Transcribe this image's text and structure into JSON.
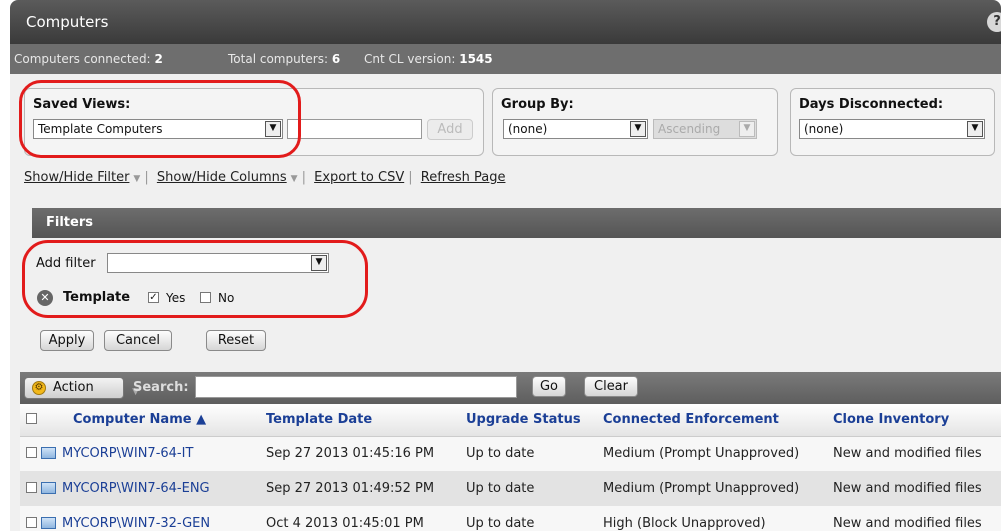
{
  "window": {
    "title": "Computers",
    "help_icon": "?"
  },
  "info": {
    "connected_label": "Computers connected:",
    "connected_value": "2",
    "total_label": "Total computers:",
    "total_value": "6",
    "cl_label": "Cnt CL version:",
    "cl_value": "1545"
  },
  "saved_views": {
    "label": "Saved Views:",
    "value": "Template Computers",
    "name_value": "",
    "add_label": "Add"
  },
  "group_by": {
    "label": "Group By:",
    "value": "(none)",
    "order_value": "Ascending"
  },
  "days_disconnected": {
    "label": "Days Disconnected:",
    "value": "(none)"
  },
  "links": {
    "show_hide_filter": "Show/Hide Filter",
    "show_hide_columns": "Show/Hide Columns",
    "export_csv": "Export to CSV",
    "refresh": "Refresh Page"
  },
  "filters": {
    "heading": "Filters",
    "add_filter_label": "Add filter",
    "add_filter_value": "",
    "template_label": "Template",
    "yes_label": "Yes",
    "yes_checked": true,
    "no_label": "No",
    "no_checked": false
  },
  "filter_buttons": {
    "apply": "Apply",
    "cancel": "Cancel",
    "reset": "Reset"
  },
  "toolbar": {
    "action_label": "Action",
    "search_label": "Search:",
    "search_value": "",
    "go_label": "Go",
    "clear_label": "Clear"
  },
  "table": {
    "columns": [
      "Computer Name ▲",
      "Template Date",
      "Upgrade Status",
      "Connected Enforcement",
      "Clone Inventory"
    ],
    "rows": [
      {
        "name": "MYCORP\\WIN7-64-IT",
        "template_date": "Sep 27 2013 01:45:16 PM",
        "upgrade": "Up to date",
        "enforcement": "Medium (Prompt Unapproved)",
        "clone": "New and modified files"
      },
      {
        "name": "MYCORP\\WIN7-64-ENG",
        "template_date": "Sep 27 2013 01:49:52 PM",
        "upgrade": "Up to date",
        "enforcement": "Medium (Prompt Unapproved)",
        "clone": "New and modified files"
      },
      {
        "name": "MYCORP\\WIN7-32-GEN",
        "template_date": "Oct 4 2013 01:45:01 PM",
        "upgrade": "Up to date",
        "enforcement": "High (Block Unapproved)",
        "clone": "New and modified files"
      }
    ]
  },
  "colors": {
    "annotation": "#e21b1b",
    "link": "#1b3f96",
    "header_bar": "#4a4a4a",
    "action_icon": "#f2b81a"
  }
}
